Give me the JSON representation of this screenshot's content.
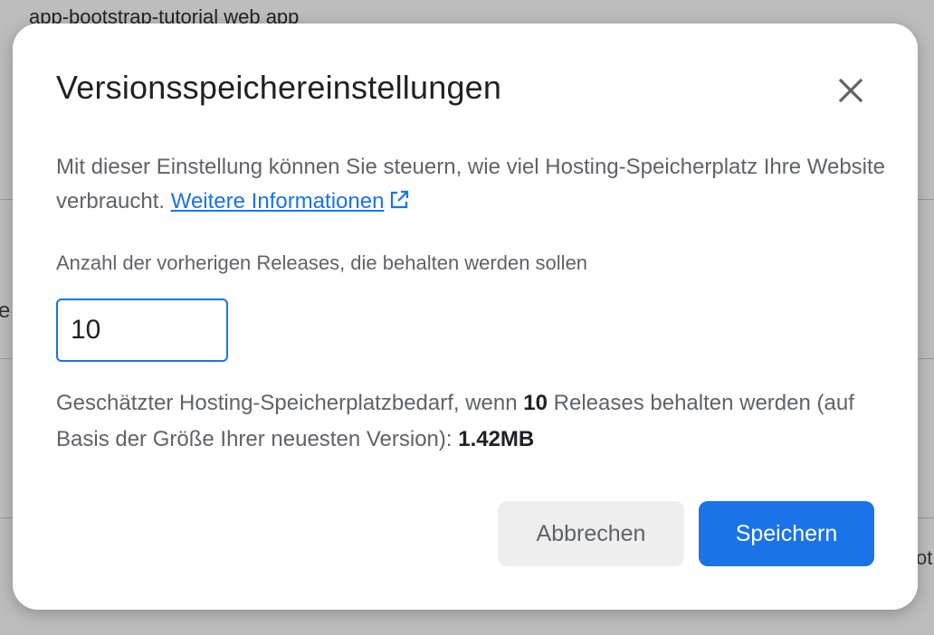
{
  "background": {
    "page_title": "app-bootstrap-tutorial web app",
    "fragment_left": "e",
    "fragment_right": "ot"
  },
  "dialog": {
    "title": "Versionsspeichereinstellungen",
    "close_icon": "close-icon",
    "description": {
      "text": "Mit dieser Einstellung können Sie steuern, wie viel Hosting-Speicherplatz Ihre Website verbraucht. ",
      "link_label": "Weitere Informationen",
      "link_icon": "open-in-new-icon"
    },
    "field": {
      "label": "Anzahl der vorherigen Releases, die behalten werden sollen",
      "value": "10"
    },
    "estimate": {
      "prefix": "Geschätzter Hosting-Speicherplatzbedarf, wenn ",
      "count": "10",
      "middle": " Releases behalten werden (auf Basis der Größe Ihrer neuesten Version): ",
      "size": "1.42MB"
    },
    "buttons": {
      "cancel_label": "Abbrechen",
      "save_label": "Speichern"
    }
  },
  "colors": {
    "accent": "#1a73e8",
    "backdrop": "#7c7c7c",
    "secondary_text": "#5f6368",
    "primary_text": "#202124",
    "cancel_bg": "#eeeeee"
  }
}
